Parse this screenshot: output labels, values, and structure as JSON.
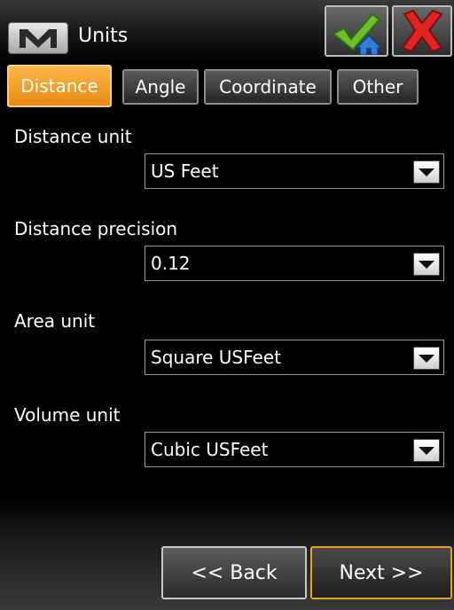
{
  "titlebar": {
    "title": "Units",
    "menu_icon": "m-logo-icon",
    "ok_icon": "checkmark-home-icon",
    "close_icon": "close-x-icon"
  },
  "tabs": [
    {
      "label": "Distance",
      "active": true
    },
    {
      "label": "Angle",
      "active": false
    },
    {
      "label": "Coordinate",
      "active": false
    },
    {
      "label": "Other",
      "active": false
    }
  ],
  "fields": {
    "distance_unit": {
      "label": "Distance unit",
      "value": "US Feet"
    },
    "distance_precision": {
      "label": "Distance precision",
      "value": "0.12"
    },
    "area_unit": {
      "label": "Area unit",
      "value": "Square USFeet"
    },
    "volume_unit": {
      "label": "Volume unit",
      "value": "Cubic USFeet"
    }
  },
  "nav": {
    "back_label": "<< Back",
    "next_label": "Next >>"
  },
  "colors": {
    "active_tab": "#f39c1f",
    "ok_check": "#7ac943",
    "close_x": "#d21e1e",
    "background": "#000000"
  }
}
